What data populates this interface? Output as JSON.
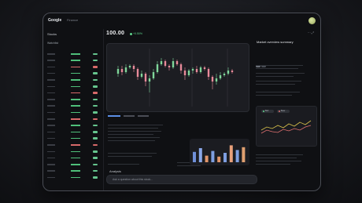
{
  "window": {
    "brand": "Google",
    "brand_sub": "Finance"
  },
  "left_panel": {
    "title": "Stocks",
    "header": "Watchlist",
    "rows": [
      {
        "dir": "up"
      },
      {
        "dir": "up"
      },
      {
        "dir": "down"
      },
      {
        "dir": "up"
      },
      {
        "dir": "up"
      },
      {
        "dir": "up"
      },
      {
        "dir": "down"
      },
      {
        "dir": "up"
      },
      {
        "dir": "up"
      },
      {
        "dir": "up"
      },
      {
        "dir": "down"
      },
      {
        "dir": "up"
      },
      {
        "dir": "up"
      },
      {
        "dir": "up"
      },
      {
        "dir": "down"
      },
      {
        "dir": "up"
      },
      {
        "dir": "up"
      },
      {
        "dir": "up"
      },
      {
        "dir": "up"
      },
      {
        "dir": "up"
      }
    ]
  },
  "main": {
    "price": "100.00",
    "change": "+0.50%",
    "chart": {
      "candles": [
        {
          "o": 52,
          "c": 55,
          "h": 57,
          "l": 50
        },
        {
          "o": 55,
          "c": 53,
          "h": 57,
          "l": 51
        },
        {
          "o": 53,
          "c": 56,
          "h": 58,
          "l": 52
        },
        {
          "o": 56,
          "c": 57,
          "h": 58,
          "l": 55
        },
        {
          "o": 57,
          "c": 55,
          "h": 58,
          "l": 53
        },
        {
          "o": 55,
          "c": 50,
          "h": 56,
          "l": 48
        },
        {
          "o": 50,
          "c": 52,
          "h": 54,
          "l": 49
        },
        {
          "o": 52,
          "c": 47,
          "h": 53,
          "l": 44
        },
        {
          "o": 47,
          "c": 49,
          "h": 51,
          "l": 40
        },
        {
          "o": 49,
          "c": 53,
          "h": 55,
          "l": 48
        },
        {
          "o": 53,
          "c": 58,
          "h": 60,
          "l": 52
        },
        {
          "o": 58,
          "c": 60,
          "h": 62,
          "l": 57
        },
        {
          "o": 60,
          "c": 57,
          "h": 61,
          "l": 56
        },
        {
          "o": 57,
          "c": 56,
          "h": 58,
          "l": 54
        },
        {
          "o": 56,
          "c": 60,
          "h": 62,
          "l": 55
        },
        {
          "o": 60,
          "c": 58,
          "h": 61,
          "l": 57
        },
        {
          "o": 58,
          "c": 54,
          "h": 59,
          "l": 52
        },
        {
          "o": 54,
          "c": 51,
          "h": 56,
          "l": 48
        },
        {
          "o": 51,
          "c": 54,
          "h": 55,
          "l": 50
        },
        {
          "o": 54,
          "c": 55,
          "h": 56,
          "l": 52
        },
        {
          "o": 55,
          "c": 53,
          "h": 57,
          "l": 52
        },
        {
          "o": 53,
          "c": 56,
          "h": 57,
          "l": 52
        },
        {
          "o": 56,
          "c": 55,
          "h": 57,
          "l": 54
        },
        {
          "o": 55,
          "c": 50,
          "h": 56,
          "l": 48
        },
        {
          "o": 50,
          "c": 47,
          "h": 51,
          "l": 42
        },
        {
          "o": 47,
          "c": 49,
          "h": 52,
          "l": 45
        },
        {
          "o": 49,
          "c": 51,
          "h": 53,
          "l": 48
        },
        {
          "o": 51,
          "c": 52,
          "h": 53,
          "l": 50
        },
        {
          "o": 52,
          "c": 54,
          "h": 56,
          "l": 51
        },
        {
          "o": 54,
          "c": 53,
          "h": 55,
          "l": 52
        }
      ],
      "colors": {
        "up": "#7fd69a",
        "down": "#e98a9a"
      }
    },
    "bars": {
      "values": [
        0.55,
        0.75,
        0.35,
        0.6,
        0.3,
        0.5,
        0.9,
        0.65,
        0.8
      ],
      "colors": [
        "#6f8fd8",
        "#8aa7e8",
        "#e0956a",
        "#7e9ee0",
        "#e0956a",
        "#7e9ee0",
        "#e8a07a",
        "#7e9ee0",
        "#e0a070"
      ]
    },
    "section_label": "Analysis",
    "input_placeholder": "Ask a question about this stock..."
  },
  "right_panel": {
    "icons": "⋯  ⤢",
    "title": "Market overview summary",
    "pills": [
      {
        "label": "Bull",
        "color": "#5fd38c"
      },
      {
        "label": "Bear",
        "color": "#e07070"
      }
    ],
    "line_colors": {
      "a": "#d9c24a",
      "b": "#e07070"
    }
  },
  "colors": {
    "accent": "#5b8fe6",
    "up": "#5fd38c",
    "down": "#d86a6a"
  }
}
